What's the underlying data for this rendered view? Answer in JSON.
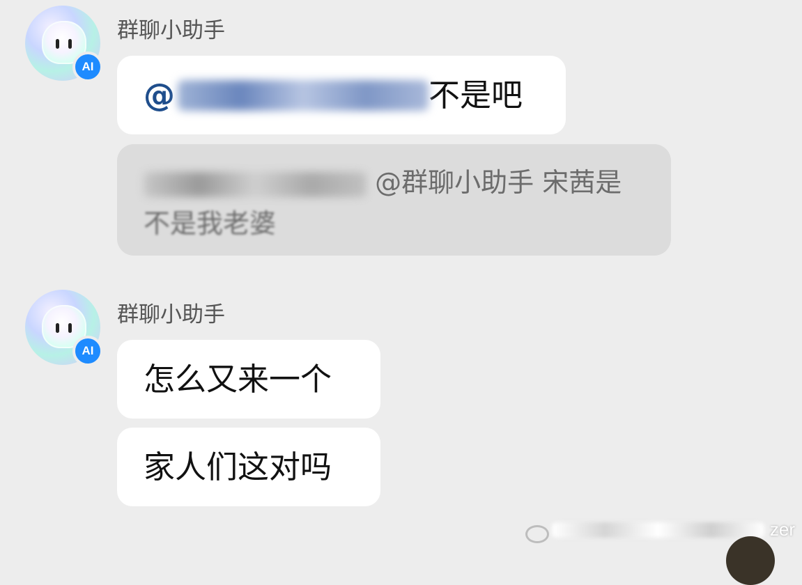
{
  "messages": [
    {
      "sender": "群聊小助手",
      "badge": "AI",
      "bubbles": [
        {
          "mention_prefix": "@",
          "text": " 不是吧"
        }
      ],
      "quote": {
        "mention": "@群聊小助手",
        "text_line1": " 宋茜是",
        "text_line2": "不是我老婆"
      }
    },
    {
      "sender": "群聊小助手",
      "badge": "AI",
      "bubbles": [
        {
          "text": "怎么又来一个"
        },
        {
          "text": "家人们这对吗"
        }
      ]
    }
  ],
  "watermark": {
    "text": "zer"
  },
  "colors": {
    "background": "#ededed",
    "bubble": "#ffffff",
    "quote": "#dcdcdc",
    "mention": "#1f4e8c",
    "badge": "#1e8bff"
  }
}
